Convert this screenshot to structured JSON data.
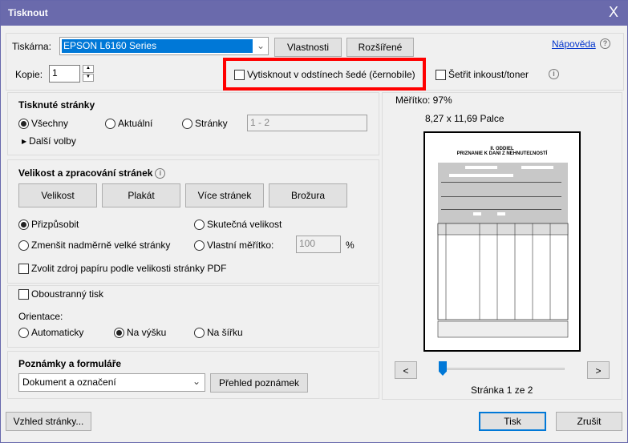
{
  "window": {
    "title": "Tisknout",
    "close": "X"
  },
  "printer": {
    "label": "Tiskárna:",
    "value": "EPSON L6160 Series",
    "properties": "Vlastnosti",
    "advanced": "Rozšířené",
    "help": "Nápověda",
    "help_icon": "?"
  },
  "copies": {
    "label": "Kopie:",
    "value": "1"
  },
  "options": {
    "grayscale": "Vytisknout v odstínech šedé (černobíle)",
    "save_ink": "Šetřit inkoust/toner",
    "info_icon": "i"
  },
  "pages": {
    "title": "Tisknuté stránky",
    "all": "Všechny",
    "current": "Aktuální",
    "pages": "Stránky",
    "range": "1 - 2",
    "more": "Další volby"
  },
  "sizing": {
    "title": "Velikost a zpracování stránek",
    "buttons": [
      "Velikost",
      "Plakát",
      "Více stránek",
      "Brožura"
    ],
    "fit": "Přizpůsobit",
    "actual": "Skutečná velikost",
    "shrink": "Zmenšit nadměrně velké stránky",
    "custom": "Vlastní měřítko:",
    "scale": "100",
    "percent": "%",
    "paper_source": "Zvolit zdroj papíru podle velikosti stránky PDF"
  },
  "duplex": {
    "label": "Oboustranný tisk",
    "orientation": "Orientace:",
    "auto": "Automaticky",
    "portrait": "Na výšku",
    "landscape": "Na šířku"
  },
  "comments": {
    "title": "Poznámky a formuláře",
    "value": "Dokument a označení",
    "summary": "Přehled poznámek"
  },
  "preview": {
    "scale": "Měřítko:  97%",
    "size": "8,27 x 11,69 Palce",
    "doc_heading": "II. ODDIEL",
    "doc_title": "PRIZNANIE K DANI Z NEHNUTEĽNOSTÍ",
    "prev": "<",
    "next": ">",
    "page_label": "Stránka 1 ze 2",
    "slider_fraction": 0
  },
  "footer": {
    "page_setup": "Vzhled stránky...",
    "print": "Tisk",
    "cancel": "Zrušit"
  },
  "colors": {
    "titlebar": "#6a6aac",
    "highlight": "#ff0000",
    "selection": "#0078d7"
  }
}
